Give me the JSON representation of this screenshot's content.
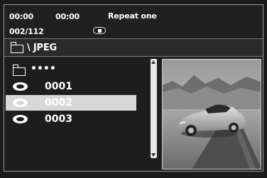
{
  "status": {
    "elapsed_time": "00:00",
    "total_time": "00:00",
    "repeat_mode": "Repeat one",
    "track_counter": "002/112",
    "play_state_icon": "stop-icon"
  },
  "path": {
    "folder_icon": "folder-icon",
    "label": "\\ JPEG"
  },
  "file_list": {
    "parent_folder": {
      "icon": "folder-icon",
      "label": "••••"
    },
    "items": [
      {
        "icon": "disc-icon",
        "label": "0001",
        "selected": false
      },
      {
        "icon": "disc-icon",
        "label": "0002",
        "selected": true
      },
      {
        "icon": "disc-icon",
        "label": "0003",
        "selected": false
      }
    ]
  },
  "preview": {
    "description_icon": "photo-preview"
  },
  "colors": {
    "background": "#1c1c1c",
    "selection": "#d8d8d8",
    "text": "#ffffff"
  }
}
